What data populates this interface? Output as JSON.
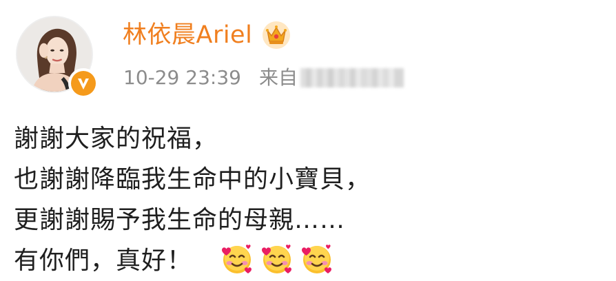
{
  "post": {
    "username": "林依晨Ariel",
    "timestamp": "10-29 23:39",
    "source_label": "来自",
    "icons": {
      "avatar": "profile-photo",
      "verified": "verified-v-badge-icon",
      "crown": "crown-vip-icon",
      "emoji": "smiling-face-with-hearts-icon"
    },
    "colors": {
      "username": "#f07f1f",
      "meta": "#8c8c8c",
      "badge": "#f59a1b",
      "text": "#1f1f1f"
    },
    "lines": [
      "謝謝大家的祝福，",
      "也謝謝降臨我生命中的小寶貝，",
      "更謝謝賜予我生命的母親……",
      "有你們，真好！"
    ],
    "emoji_count": 3
  }
}
